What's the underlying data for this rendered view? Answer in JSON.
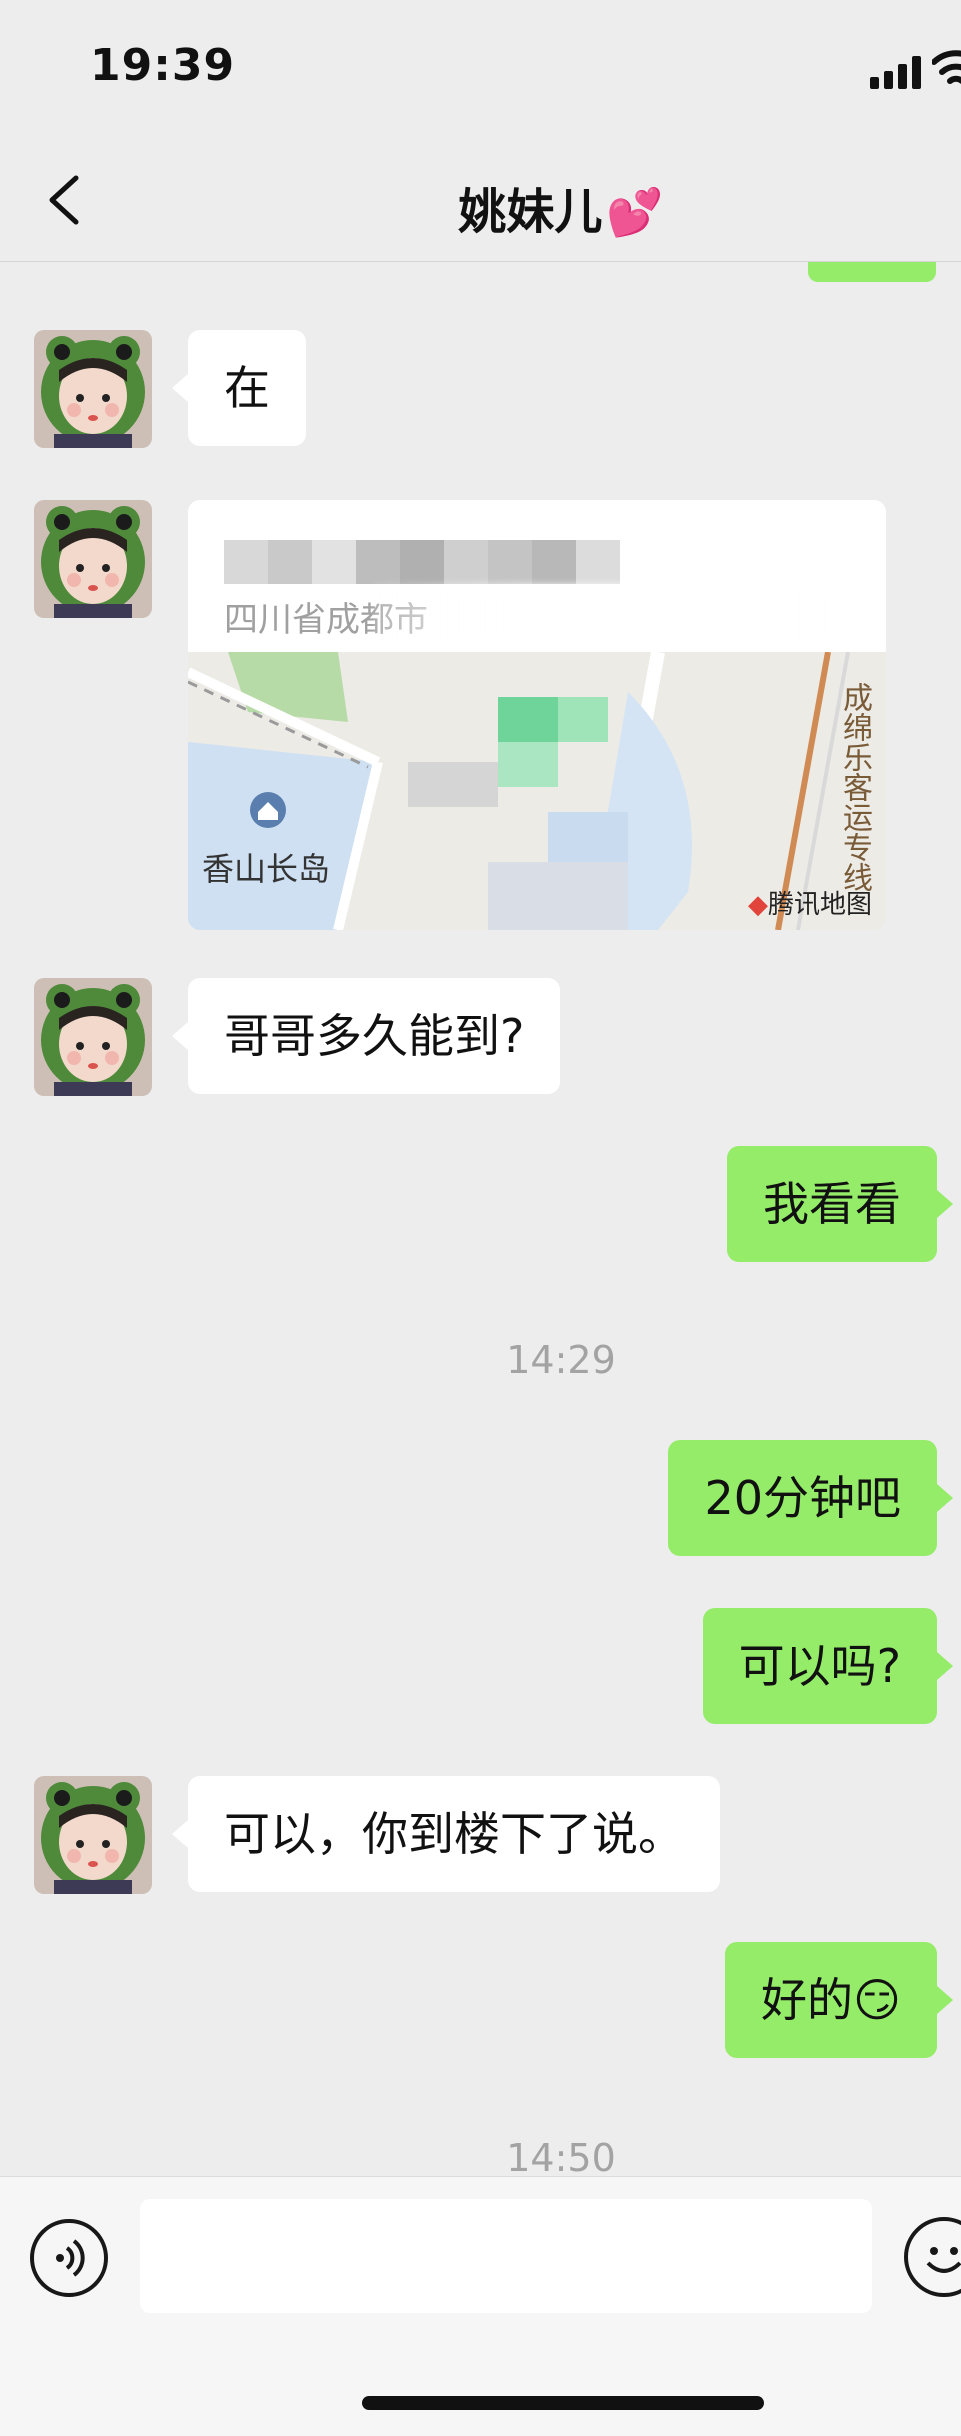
{
  "status_bar": {
    "time": "19:39"
  },
  "nav": {
    "title": "姚妹儿",
    "title_emoji": "💕"
  },
  "messages": [
    {
      "side": "in",
      "text": "在"
    },
    {
      "side": "in",
      "type": "location",
      "address": "四川省成都市",
      "map_place": "香山长岛",
      "map_rail": "成绵乐客运专线",
      "map_attribution": "腾讯地图"
    },
    {
      "side": "in",
      "text": "哥哥多久能到?"
    },
    {
      "side": "out",
      "text": "我看看"
    },
    {
      "type": "time",
      "text": "14:29"
    },
    {
      "side": "out",
      "text": "20分钟吧"
    },
    {
      "side": "out",
      "text": "可以吗?"
    },
    {
      "side": "in",
      "text": "可以，你到楼下了说。"
    },
    {
      "side": "out",
      "text": "好的😏"
    },
    {
      "type": "time",
      "text": "14:50"
    }
  ],
  "input_bar": {
    "placeholder": ""
  },
  "colors": {
    "background": "#ededed",
    "out_bubble": "#95ec69",
    "in_bubble": "#ffffff",
    "timestamp": "#a3a3a3"
  }
}
